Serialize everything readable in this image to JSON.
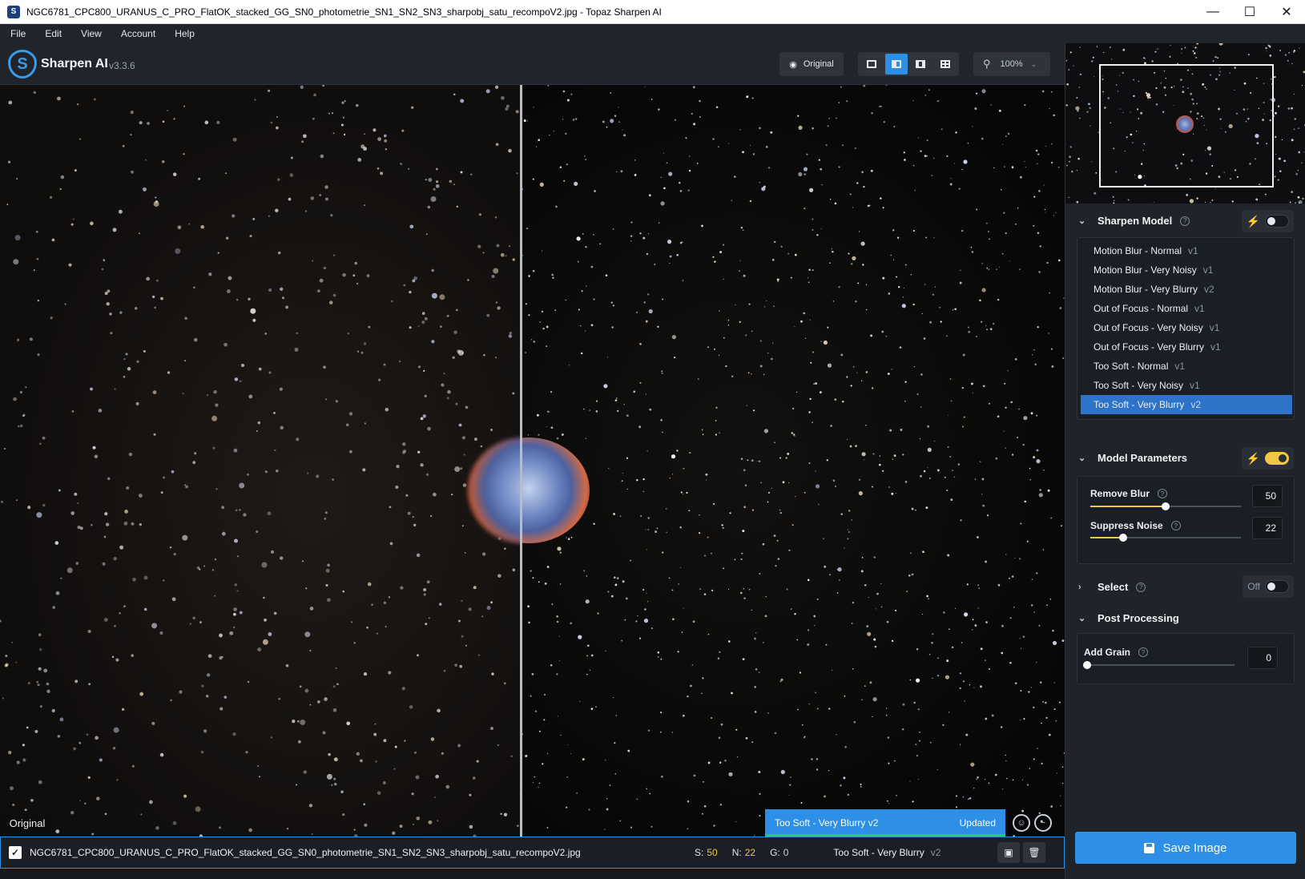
{
  "window": {
    "title": "NGC6781_CPC800_URANUS_C_PRO_FlatOK_stacked_GG_SN0_photometrie_SN1_SN2_SN3_sharpobj_satu_recompoV2.jpg - Topaz Sharpen AI",
    "controls": [
      "minimize",
      "maximize",
      "close"
    ]
  },
  "menu": [
    "File",
    "Edit",
    "View",
    "Account",
    "Help"
  ],
  "header": {
    "app_name": "Sharpen AI",
    "version": "v3.3.6",
    "original_button": "Original",
    "zoom_level": "100%",
    "view_modes": [
      "single-view",
      "split-view",
      "side-by-side",
      "quad-view"
    ],
    "active_view_mode": "split-view"
  },
  "viewer": {
    "left_label": "Original",
    "status_model": "Too Soft - Very Blurry v2",
    "status_state": "Updated"
  },
  "file_row": {
    "checked": true,
    "file_name": "NGC6781_CPC800_URANUS_C_PRO_FlatOK_stacked_GG_SN0_photometrie_SN1_SN2_SN3_sharpobj_satu_recompoV2.jpg",
    "s_label": "S:",
    "s_value": "50",
    "n_label": "N:",
    "n_value": "22",
    "g_label": "G:",
    "g_value": "0",
    "model": "Too Soft - Very Blurry",
    "model_version": "v2"
  },
  "panel": {
    "sharpen_model": {
      "title": "Sharpen Model",
      "auto_enabled": false,
      "models": [
        {
          "name": "Motion Blur - Normal",
          "version": "v1"
        },
        {
          "name": "Motion Blur - Very Noisy",
          "version": "v1"
        },
        {
          "name": "Motion Blur - Very Blurry",
          "version": "v2"
        },
        {
          "name": "Out of Focus - Normal",
          "version": "v1"
        },
        {
          "name": "Out of Focus - Very Noisy",
          "version": "v1"
        },
        {
          "name": "Out of Focus - Very Blurry",
          "version": "v1"
        },
        {
          "name": "Too Soft - Normal",
          "version": "v1"
        },
        {
          "name": "Too Soft - Very Noisy",
          "version": "v1"
        },
        {
          "name": "Too Soft - Very Blurry",
          "version": "v2"
        }
      ],
      "selected_index": 8
    },
    "model_parameters": {
      "title": "Model Parameters",
      "auto_enabled": true,
      "remove_blur_label": "Remove Blur",
      "remove_blur_value": "50",
      "suppress_noise_label": "Suppress Noise",
      "suppress_noise_value": "22"
    },
    "select": {
      "title": "Select",
      "state": "Off"
    },
    "post_processing": {
      "title": "Post Processing",
      "add_grain_label": "Add Grain",
      "add_grain_value": "0"
    },
    "save_button": "Save Image"
  },
  "colors": {
    "accent_blue": "#2d8fe6",
    "accent_yellow": "#f2c744",
    "panel_bg": "#1f232a"
  }
}
